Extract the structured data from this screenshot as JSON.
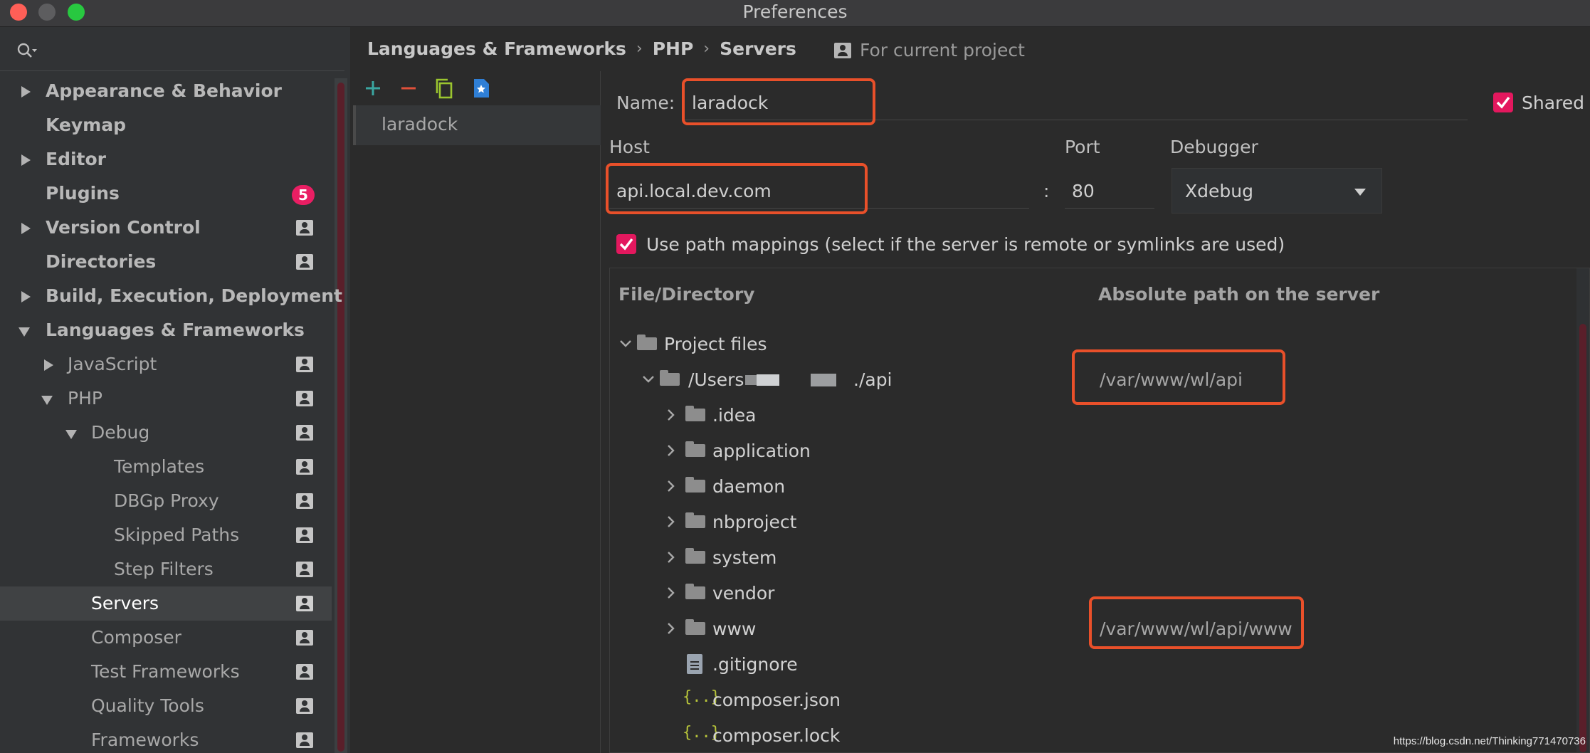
{
  "window": {
    "title": "Preferences"
  },
  "sidebar": {
    "items": [
      {
        "label": "Appearance & Behavior",
        "expander": "collapsed"
      },
      {
        "label": "Keymap"
      },
      {
        "label": "Editor",
        "expander": "collapsed"
      },
      {
        "label": "Plugins",
        "badge": "5"
      },
      {
        "label": "Version Control",
        "expander": "collapsed"
      },
      {
        "label": "Directories"
      },
      {
        "label": "Build, Execution, Deployment",
        "expander": "collapsed"
      },
      {
        "label": "Languages & Frameworks",
        "expander": "expanded"
      },
      {
        "label": "JavaScript",
        "expander": "collapsed"
      },
      {
        "label": "PHP",
        "expander": "expanded"
      },
      {
        "label": "Debug",
        "expander": "expanded"
      },
      {
        "label": "Templates"
      },
      {
        "label": "DBGp Proxy"
      },
      {
        "label": "Skipped Paths"
      },
      {
        "label": "Step Filters"
      },
      {
        "label": "Servers",
        "selected": true
      },
      {
        "label": "Composer"
      },
      {
        "label": "Test Frameworks"
      },
      {
        "label": "Quality Tools"
      },
      {
        "label": "Frameworks"
      }
    ]
  },
  "breadcrumb": [
    "Languages & Frameworks",
    "PHP",
    "Servers"
  ],
  "breadcrumb_separator": "›",
  "for_current_project": "For current project",
  "server_list": {
    "items": [
      "laradock"
    ]
  },
  "form": {
    "name_label": "Name:",
    "name_value": "laradock",
    "shared_label": "Shared",
    "host_label": "Host",
    "host_value": "api.local.dev.com",
    "port_label": "Port",
    "port_value": "80",
    "colon": ":",
    "debugger_label": "Debugger",
    "debugger_value": "Xdebug",
    "path_mappings_label": "Use path mappings (select if the server is remote or symlinks are used)"
  },
  "mappings": {
    "col_file": "File/Directory",
    "col_path": "Absolute path on the server",
    "rows": [
      {
        "label": "Project files",
        "type": "folder",
        "expander": "expanded"
      },
      {
        "label": "/Users",
        "suffix": "./api",
        "type": "folder",
        "expander": "expanded",
        "server_path": "/var/www/wl/api"
      },
      {
        "label": ".idea",
        "type": "folder",
        "expander": "collapsed"
      },
      {
        "label": "application",
        "type": "folder",
        "expander": "collapsed"
      },
      {
        "label": "daemon",
        "type": "folder",
        "expander": "collapsed"
      },
      {
        "label": "nbproject",
        "type": "folder",
        "expander": "collapsed"
      },
      {
        "label": "system",
        "type": "folder",
        "expander": "collapsed"
      },
      {
        "label": "vendor",
        "type": "folder",
        "expander": "collapsed"
      },
      {
        "label": "www",
        "type": "folder",
        "expander": "collapsed",
        "server_path": "/var/www/wl/api/www"
      },
      {
        "label": ".gitignore",
        "type": "file"
      },
      {
        "label": "composer.json",
        "type": "json"
      },
      {
        "label": "composer.lock",
        "type": "json"
      }
    ]
  },
  "watermark": "https://blog.csdn.net/Thinking771470736",
  "colors": {
    "accent_checkbox": "#e3185e",
    "highlight_box": "#e9502a",
    "badge": "#e91e63"
  }
}
